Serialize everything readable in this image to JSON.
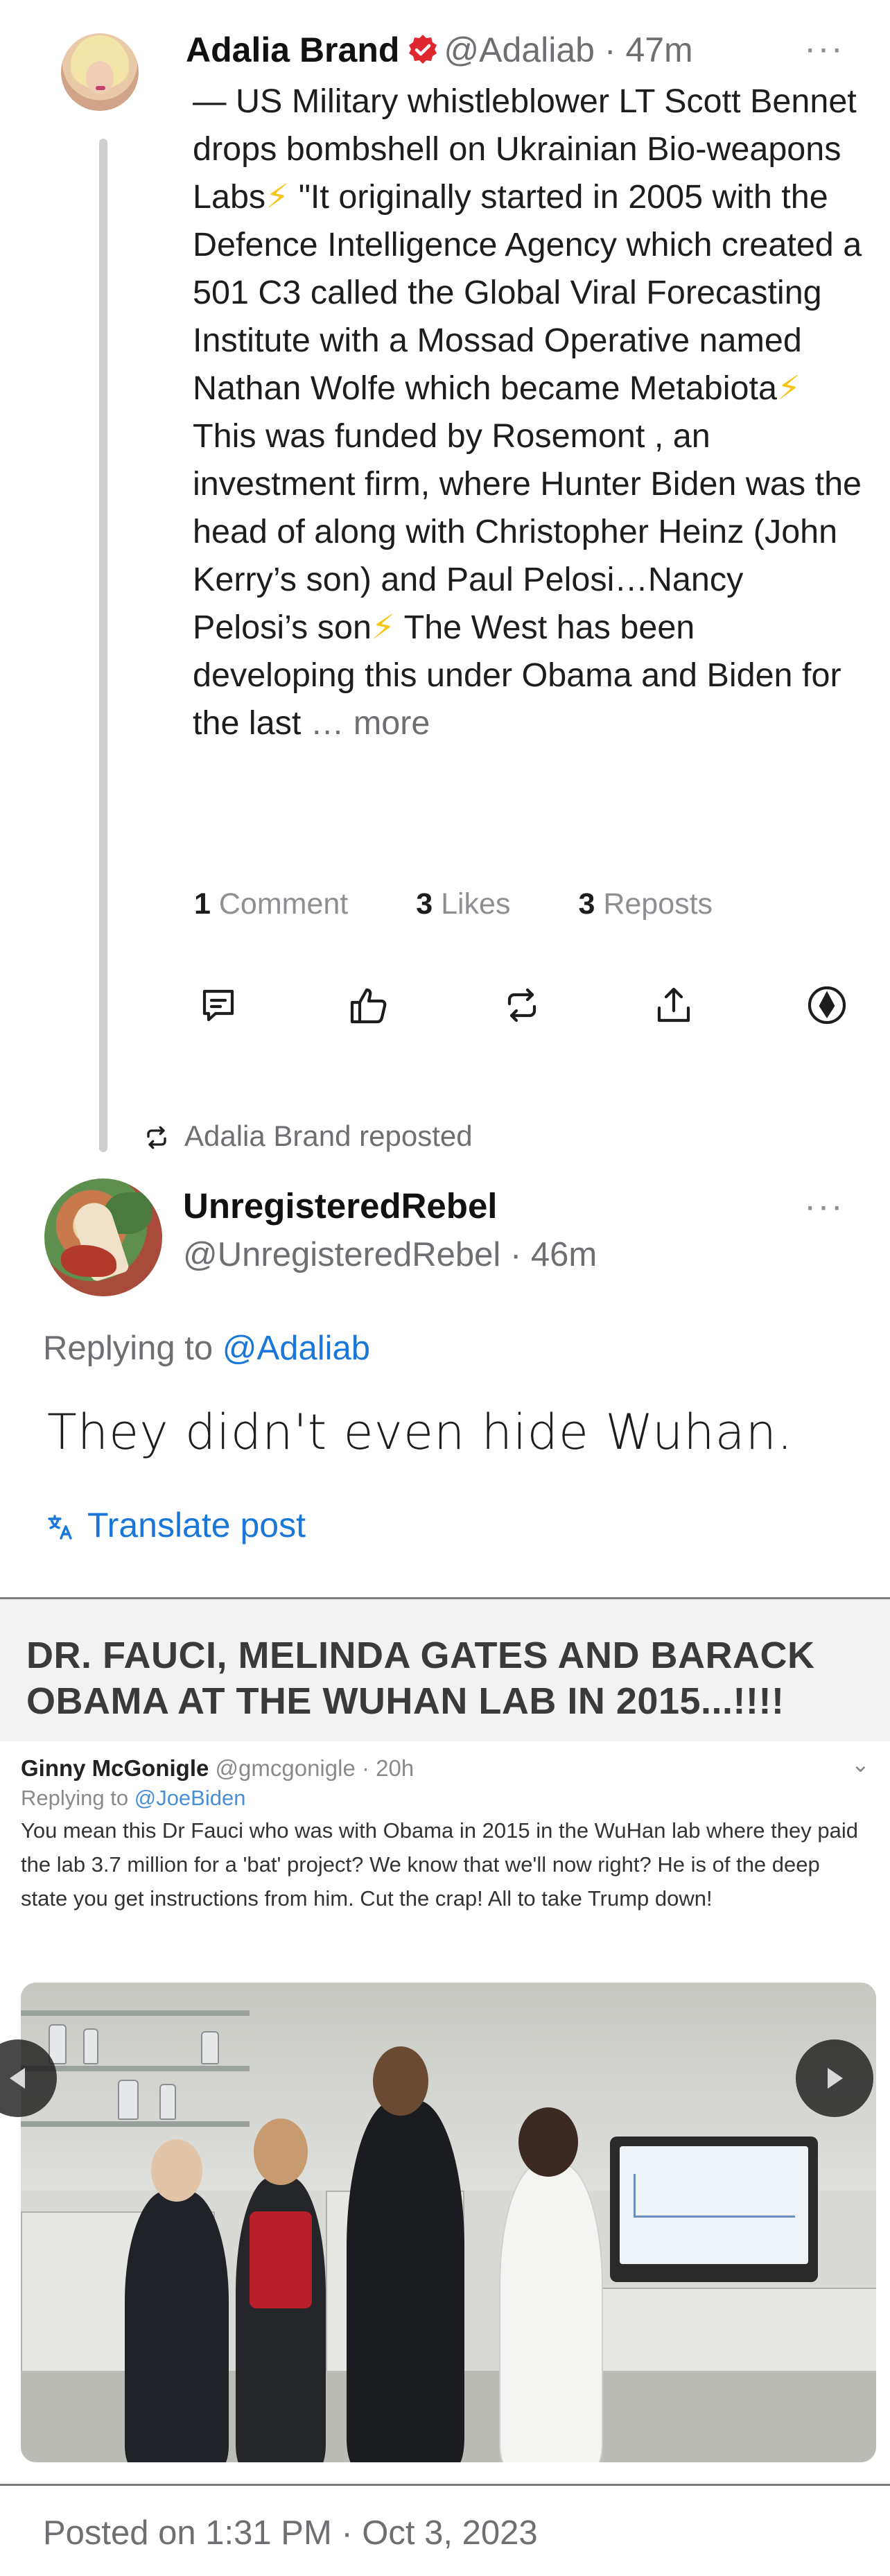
{
  "post1": {
    "author_name": "Adalia Brand",
    "author_handle": "@Adaliab",
    "time_sep": "·",
    "time": "47m",
    "more": "···",
    "text_parts": [
      "— US Military whistleblower LT Scott Bennet drops bombshell on Ukrainian Bio-weapons Labs",
      "⚡",
      " \"It originally started in 2005 with the Defence Intelligence Agency which created a 501 C3 called the Global Viral Forecasting Institute with a Mossad Operative named Nathan Wolfe which became Metabiota",
      "⚡",
      " This was funded by Rosemont , an investment firm, where Hunter Biden was the head of along with Christopher Heinz (John Kerry’s son) and Paul Pelosi…Nancy Pelosi’s son",
      "⚡",
      " The West has been developing this under Obama and Biden for the last"
    ],
    "more_link": "… more",
    "stats": {
      "comments_count": "1",
      "comments_label": "Comment",
      "likes_count": "3",
      "likes_label": "Likes",
      "reposts_count": "3",
      "reposts_label": "Reposts"
    },
    "actions": [
      "comment-icon",
      "like-icon",
      "repost-icon",
      "share-icon",
      "tip-icon"
    ],
    "verified_color": "#e0262f"
  },
  "repost_banner": {
    "name": "Adalia Brand",
    "label": "reposted"
  },
  "post2": {
    "author_name": "UnregisteredRebel",
    "author_handle": "@UnregisteredRebel",
    "time_sep": "·",
    "time": "46m",
    "more": "···",
    "replying_prefix": "Replying to",
    "replying_to": "@Adaliab",
    "text": "They didn't even hide Wuhan.",
    "translate_label": "Translate post",
    "posted_on": "Posted on 1:31 PM · Oct 3, 2023"
  },
  "embed": {
    "headline": "DR. FAUCI, MELINDA GATES AND BARACK OBAMA AT THE WUHAN LAB IN 2015...!!!!",
    "card": {
      "name": "Ginny McGonigle",
      "handle": "@gmcgonigle · 20h",
      "reply_prefix": "Replying to",
      "reply_to": "@JoeBiden",
      "text": "You mean this Dr Fauci who was with Obama in 2015 in the WuHan lab where they paid the lab 3.7 million for a 'bat' project? We know that we'll now right? He is of the deep state you get instructions from him. Cut the crap! All to take Trump down!"
    }
  },
  "colors": {
    "link_blue": "#1877d9",
    "muted_gray": "#6e6e73",
    "bolt_yellow": "#f5c518"
  }
}
